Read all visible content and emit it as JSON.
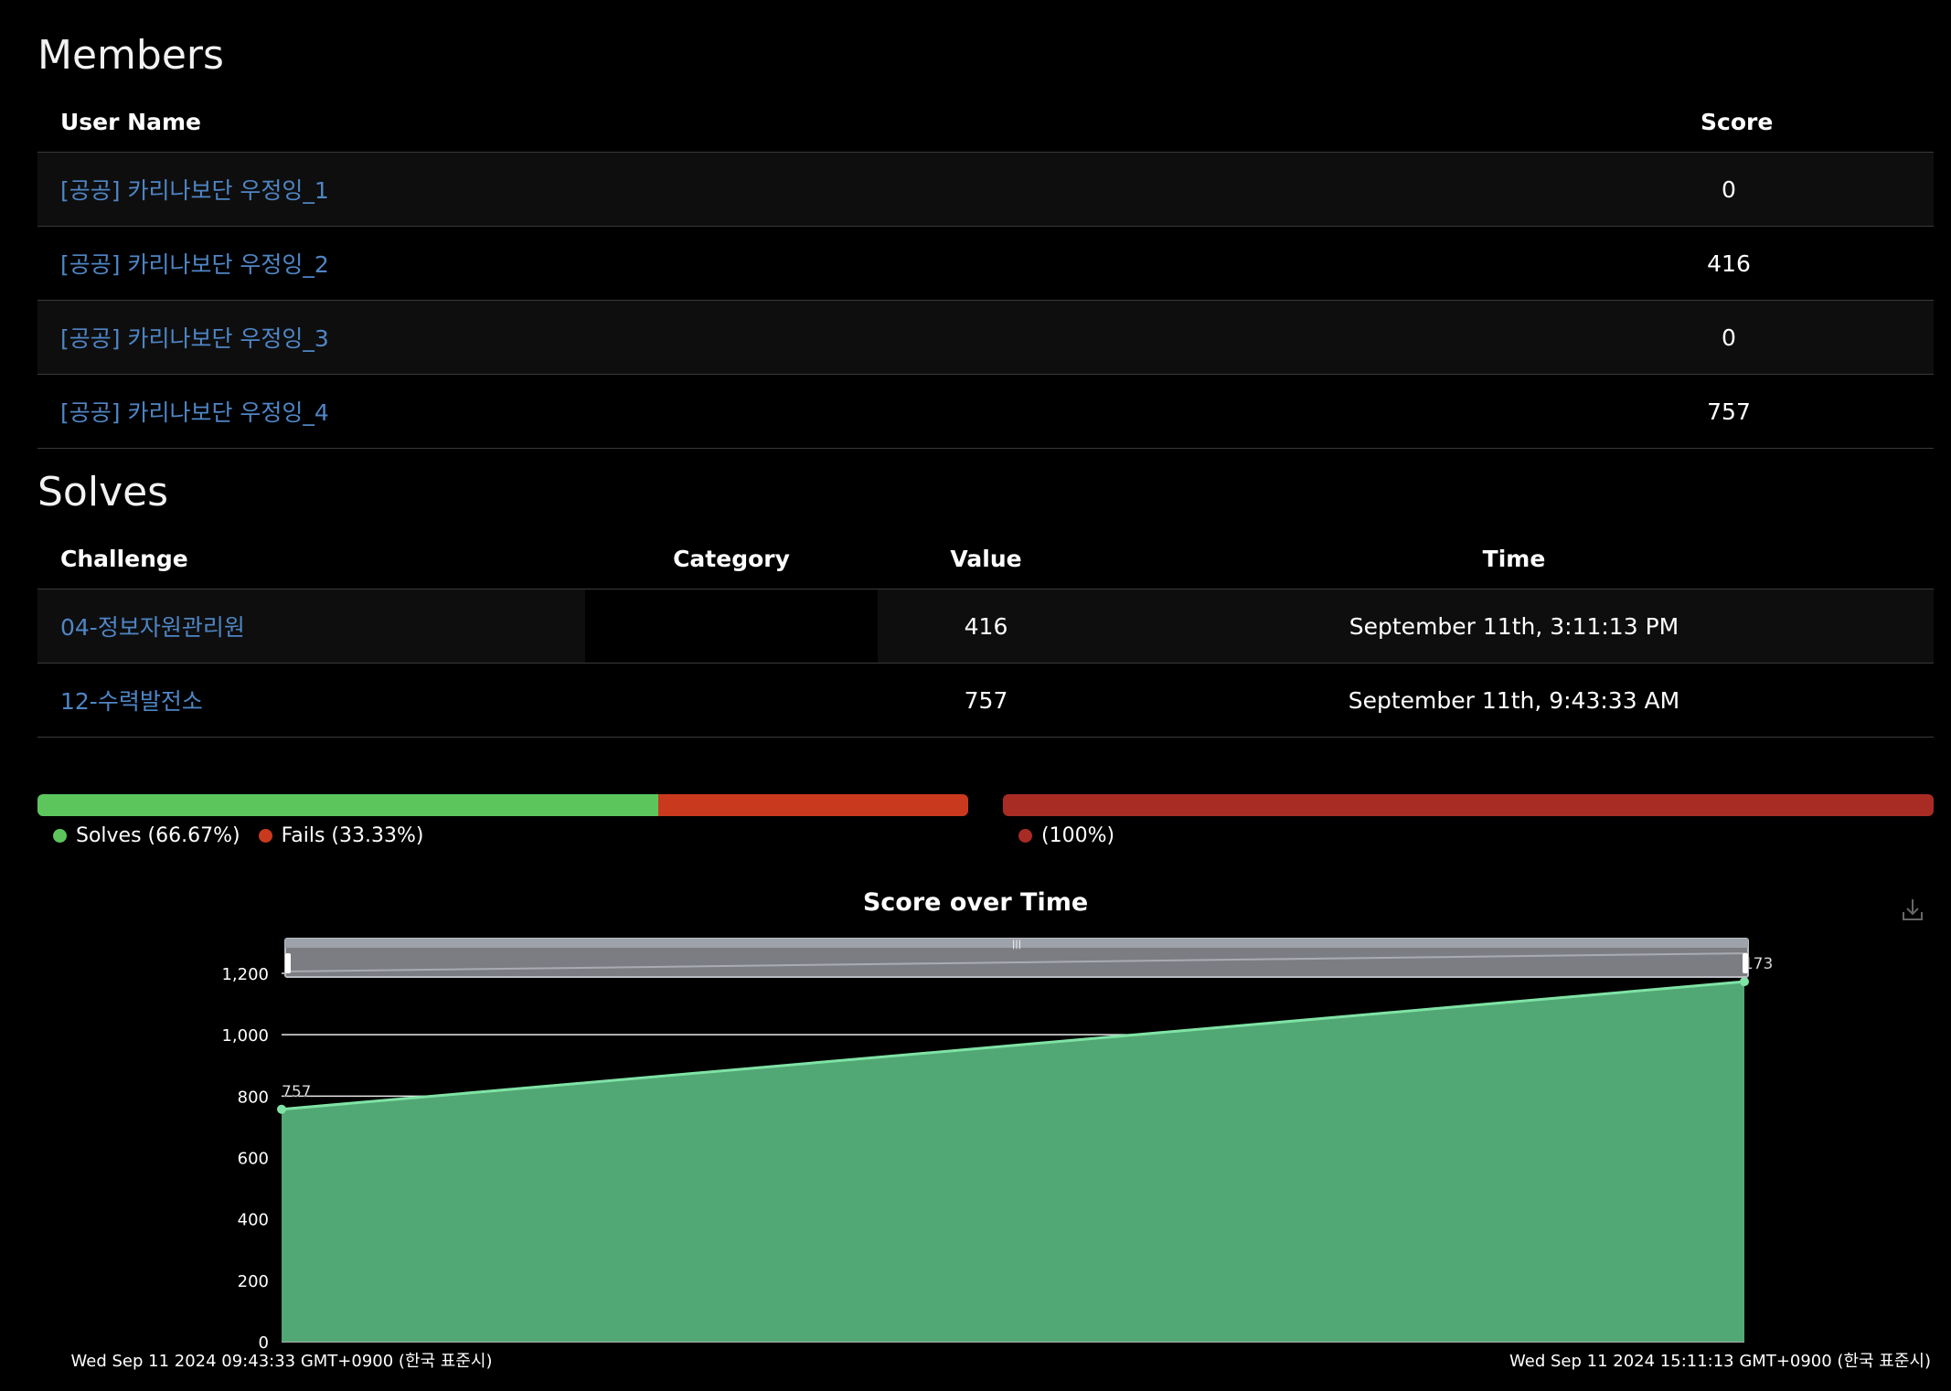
{
  "members": {
    "title": "Members",
    "headers": {
      "username": "User Name",
      "score": "Score"
    },
    "rows": [
      {
        "name": "[공공] 카리나보단 우정잉_1",
        "score": "0"
      },
      {
        "name": "[공공] 카리나보단 우정잉_2",
        "score": "416"
      },
      {
        "name": "[공공] 카리나보단 우정잉_3",
        "score": "0"
      },
      {
        "name": "[공공] 카리나보단 우정잉_4",
        "score": "757"
      }
    ]
  },
  "solves": {
    "title": "Solves",
    "headers": {
      "challenge": "Challenge",
      "category": "Category",
      "value": "Value",
      "time": "Time"
    },
    "rows": [
      {
        "challenge": "04-정보자원관리원",
        "category": "",
        "value": "416",
        "time": "September 11th, 3:11:13 PM"
      },
      {
        "challenge": "12-수력발전소",
        "category": "",
        "value": "757",
        "time": "September 11th, 9:43:33 AM"
      }
    ]
  },
  "solve_ratio": {
    "solves_pct": 66.67,
    "fails_pct": 33.33,
    "solves_label": "Solves (66.67%)",
    "fails_label": "Fails (33.33%)",
    "solves_color": "#5cc65c",
    "fails_color": "#c9391e"
  },
  "category_ratio": {
    "pct": 100,
    "label": "(100%)",
    "color": "#a82b24"
  },
  "chart_data": {
    "type": "area",
    "title": "Score over Time",
    "x": [
      "Wed Sep 11 2024 09:43:33 GMT+0900 (한국 표준시)",
      "Wed Sep 11 2024 15:11:13 GMT+0900 (한국 표준시)"
    ],
    "values": [
      757,
      1173
    ],
    "data_labels": [
      "757",
      "1173"
    ],
    "ylim": [
      0,
      1200
    ],
    "yticks": [
      "0",
      "200",
      "400",
      "600",
      "800",
      "1,000",
      "1,200"
    ],
    "grid": true,
    "fill_color": "#52a874",
    "line_color": "#7fe3a6",
    "download_icon": "download-icon"
  }
}
